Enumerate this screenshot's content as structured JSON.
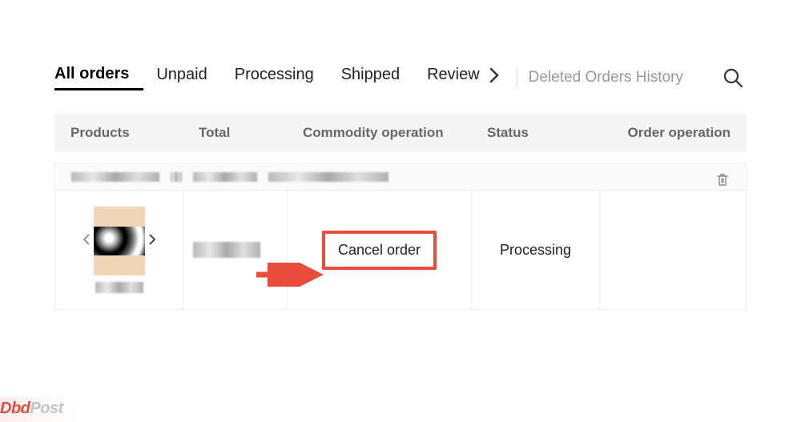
{
  "tabs": {
    "items": [
      {
        "label": "All orders",
        "active": true
      },
      {
        "label": "Unpaid",
        "active": false
      },
      {
        "label": "Processing",
        "active": false
      },
      {
        "label": "Shipped",
        "active": false
      },
      {
        "label": "Review",
        "active": false
      }
    ],
    "deleted_history_label": "Deleted Orders History"
  },
  "table_header": {
    "products": "Products",
    "total": "Total",
    "commodity_operation": "Commodity operation",
    "status": "Status",
    "order_operation": "Order operation"
  },
  "order": {
    "commodity_action": "Cancel order",
    "status": "Processing"
  },
  "watermark": {
    "part1": "Dbd",
    "part2": "Post"
  }
}
